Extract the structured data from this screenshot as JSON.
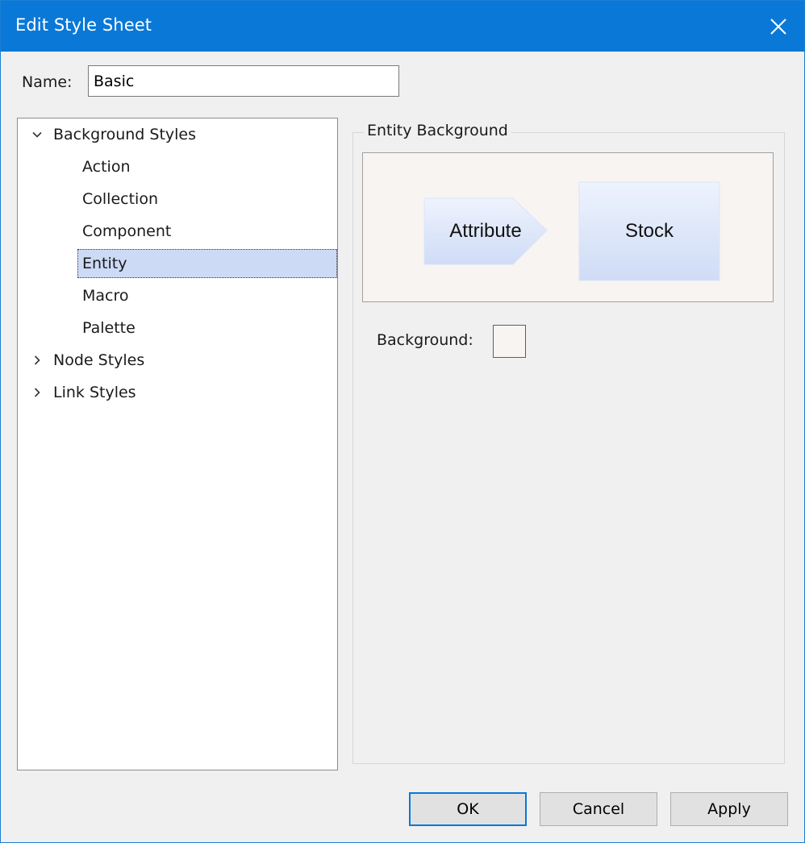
{
  "window": {
    "title": "Edit Style Sheet"
  },
  "name_field": {
    "label": "Name:",
    "value": "Basic"
  },
  "tree": {
    "background_styles": {
      "label": "Background Styles",
      "expanded": true,
      "children": [
        "Action",
        "Collection",
        "Component",
        "Entity",
        "Macro",
        "Palette"
      ],
      "selected": "Entity"
    },
    "node_styles": {
      "label": "Node Styles",
      "expanded": false
    },
    "link_styles": {
      "label": "Link Styles",
      "expanded": false
    }
  },
  "panel": {
    "group_title": "Entity Background",
    "preview": {
      "attribute_label": "Attribute",
      "stock_label": "Stock"
    },
    "background_label": "Background:",
    "background_color": "#f8f4f2"
  },
  "buttons": {
    "ok": "OK",
    "cancel": "Cancel",
    "apply": "Apply"
  },
  "icons": {
    "close": "close-icon",
    "expanded": "chevron-down-icon",
    "collapsed": "chevron-right-icon"
  },
  "colors": {
    "titlebar": "#0a78d7",
    "selection": "#ccdaf5",
    "node_fill_top": "#eef3fd",
    "node_fill_bottom": "#cfdcf6"
  }
}
